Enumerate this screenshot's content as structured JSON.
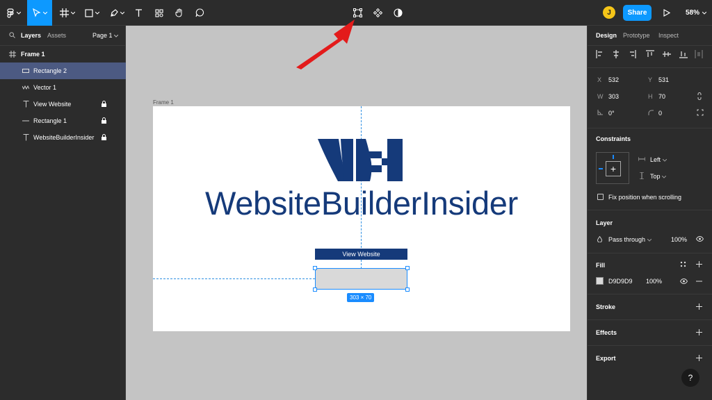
{
  "toolbar": {
    "tools": [
      "main-menu",
      "move-tool",
      "frame-tool",
      "shape-tool",
      "pen-tool",
      "text-tool",
      "resources-tool",
      "hand-tool",
      "comment-tool"
    ],
    "center_tools": [
      "edit-object-icon",
      "component-icon",
      "contrast-icon"
    ],
    "avatar_initial": "J",
    "share_label": "Share",
    "zoom_label": "58%"
  },
  "left_panel": {
    "tabs": [
      "Layers",
      "Assets"
    ],
    "page_label": "Page 1",
    "layers": [
      {
        "name": "Frame 1",
        "icon": "frame-icon",
        "locked": false,
        "selected": false
      },
      {
        "name": "Rectangle 2",
        "icon": "rectangle-icon",
        "locked": false,
        "selected": true
      },
      {
        "name": "Vector 1",
        "icon": "vector-icon",
        "locked": false,
        "selected": false
      },
      {
        "name": "View Website",
        "icon": "text-icon",
        "locked": true,
        "selected": false
      },
      {
        "name": "Rectangle 1",
        "icon": "line-icon",
        "locked": true,
        "selected": false
      },
      {
        "name": "WebsiteBuilderInsider",
        "icon": "text-icon",
        "locked": true,
        "selected": false
      }
    ]
  },
  "canvas": {
    "frame_label": "Frame 1",
    "brand_text": "WebsiteBuilderInsider",
    "button_text": "View Website",
    "dimensions_badge": "303 × 70",
    "frame_bg": "#ffffff",
    "brand_color": "#153a7a"
  },
  "right_panel": {
    "tabs": [
      "Design",
      "Prototype",
      "Inspect"
    ],
    "x_label": "X",
    "x_value": "532",
    "y_label": "Y",
    "y_value": "531",
    "w_label": "W",
    "w_value": "303",
    "h_label": "H",
    "h_value": "70",
    "rotation_value": "0°",
    "radius_value": "0",
    "constraints_title": "Constraints",
    "constraint_h": "Left",
    "constraint_v": "Top",
    "fix_position_label": "Fix position when scrolling",
    "layer_title": "Layer",
    "blend_mode": "Pass through",
    "layer_opacity": "100%",
    "fill_title": "Fill",
    "fill_hex": "D9D9D9",
    "fill_opacity": "100%",
    "stroke_title": "Stroke",
    "effects_title": "Effects",
    "export_title": "Export"
  },
  "help_label": "?",
  "accent_color": "#0d99ff"
}
